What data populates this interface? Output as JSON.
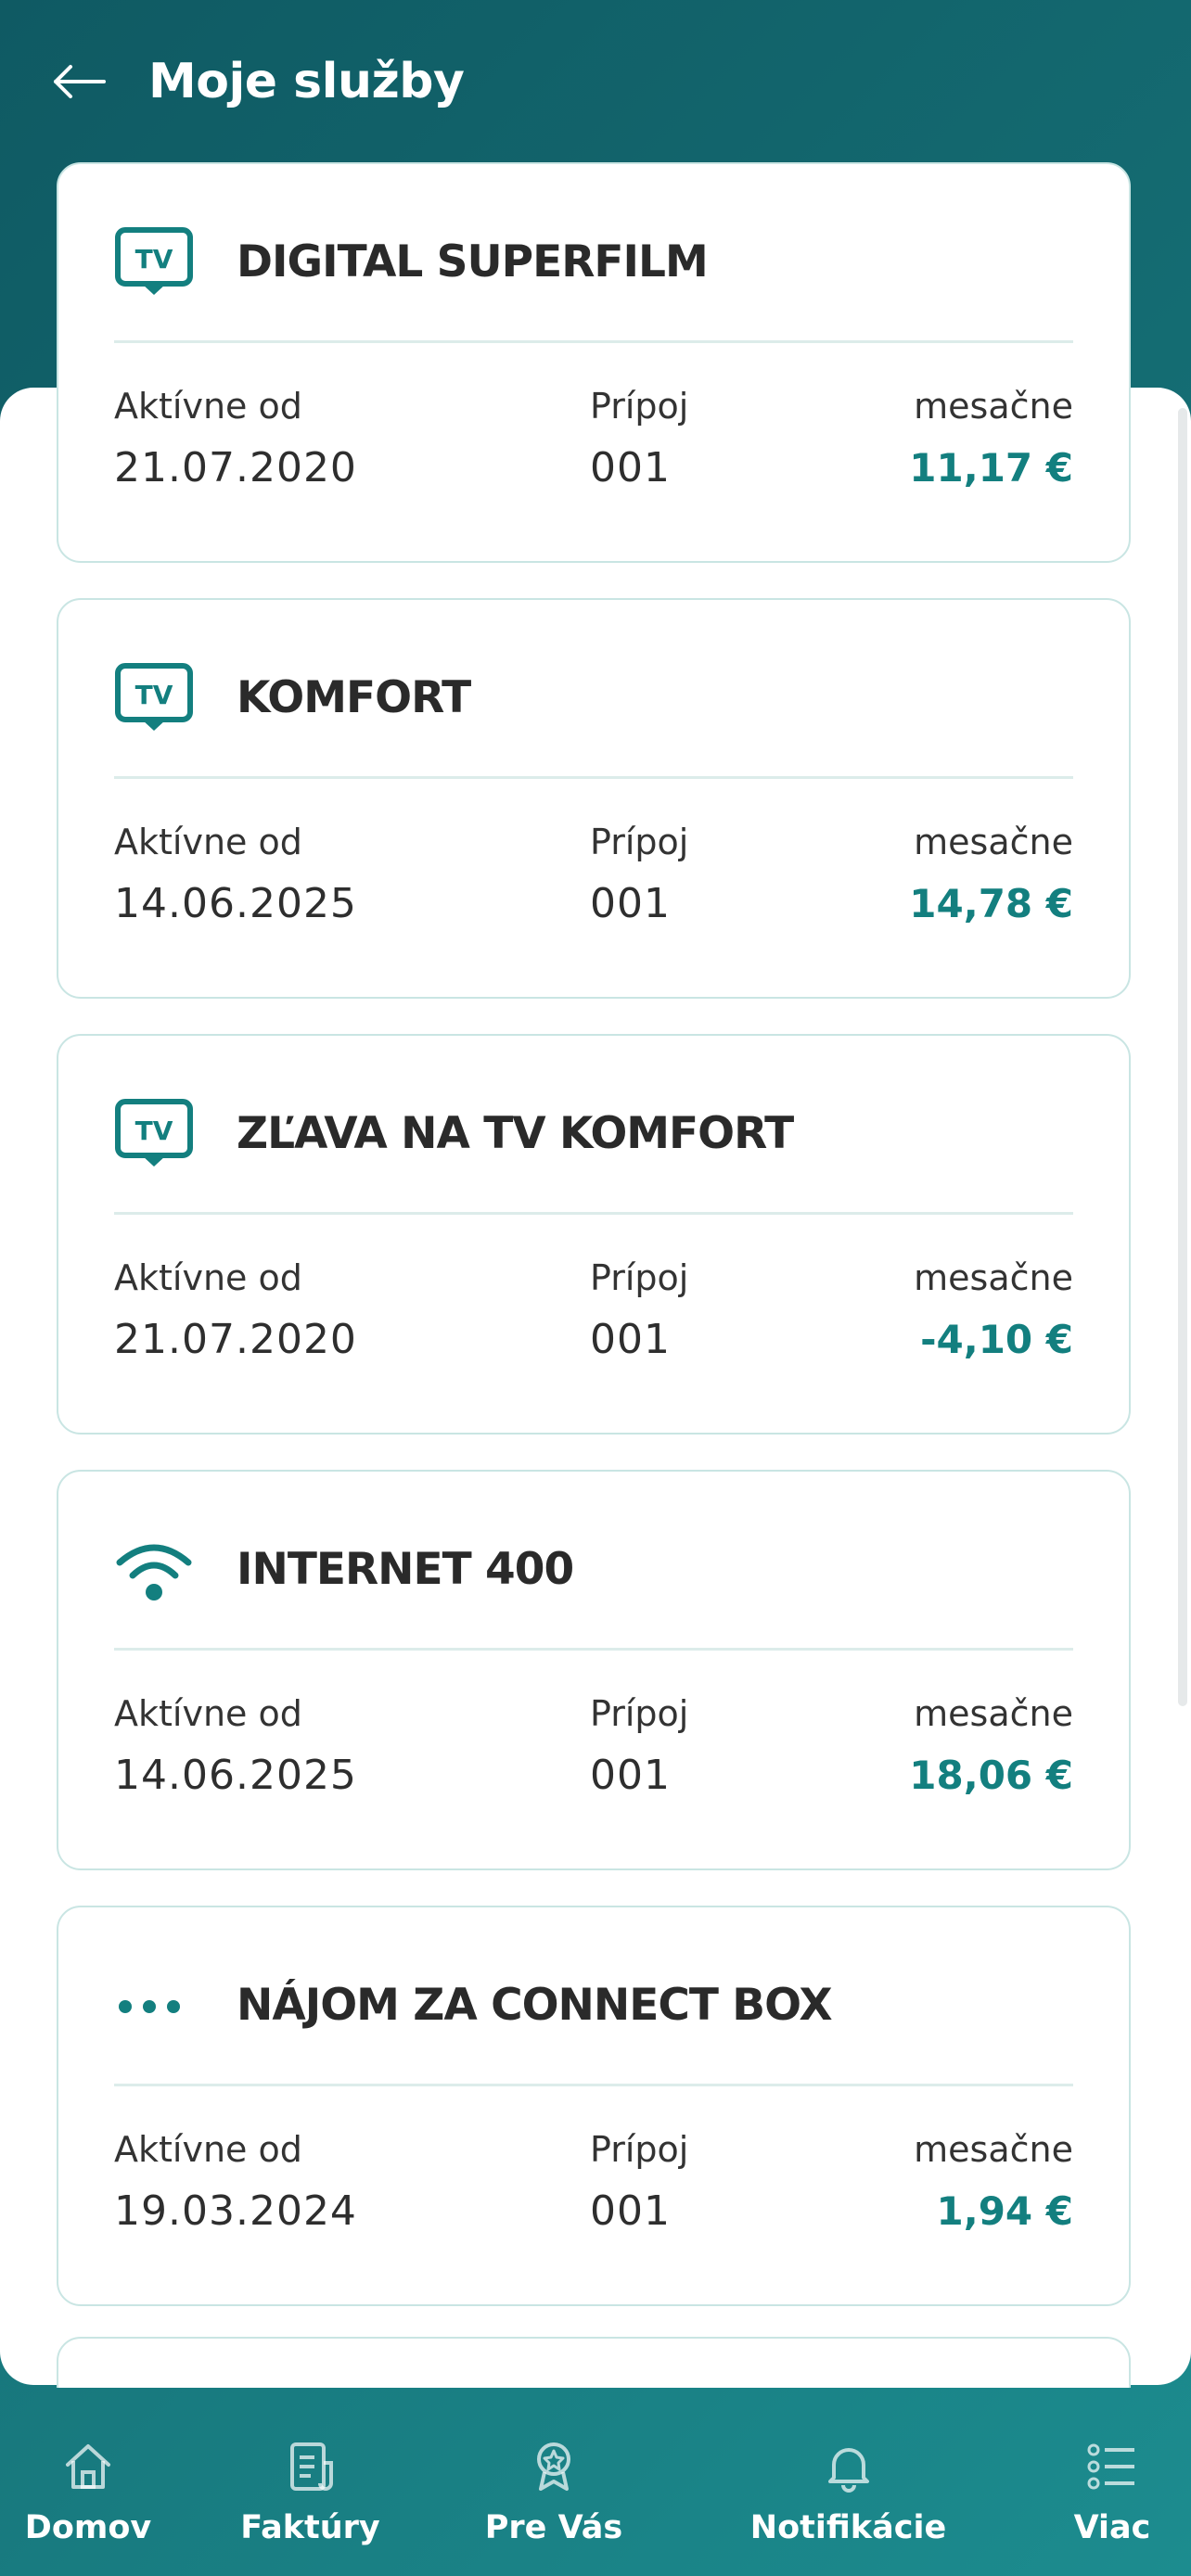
{
  "header": {
    "title": "Moje služby",
    "back_icon": "arrow-left-icon"
  },
  "services": [
    {
      "icon": "tv-icon",
      "name": "DIGITAL SUPERFILM",
      "active_label": "Aktívne od",
      "active_since": "21.07.2020",
      "connection_label": "Prípoj",
      "connection": "001",
      "monthly_label": "mesačne",
      "price": "11,17 €"
    },
    {
      "icon": "tv-icon",
      "name": "KOMFORT",
      "active_label": "Aktívne od",
      "active_since": "14.06.2025",
      "connection_label": "Prípoj",
      "connection": "001",
      "monthly_label": "mesačne",
      "price": "14,78 €"
    },
    {
      "icon": "tv-icon",
      "name": "ZĽAVA NA TV KOMFORT",
      "active_label": "Aktívne od",
      "active_since": "21.07.2020",
      "connection_label": "Prípoj",
      "connection": "001",
      "monthly_label": "mesačne",
      "price": "-4,10 €"
    },
    {
      "icon": "wifi-icon",
      "name": "INTERNET 400",
      "active_label": "Aktívne od",
      "active_since": "14.06.2025",
      "connection_label": "Prípoj",
      "connection": "001",
      "monthly_label": "mesačne",
      "price": "18,06 €"
    },
    {
      "icon": "more-dots-icon",
      "name": "NÁJOM ZA CONNECT BOX",
      "active_label": "Aktívne od",
      "active_since": "19.03.2024",
      "connection_label": "Prípoj",
      "connection": "001",
      "monthly_label": "mesačne",
      "price": "1,94 €"
    }
  ],
  "bottom_nav": [
    {
      "label": "Domov",
      "icon": "home-icon"
    },
    {
      "label": "Faktúry",
      "icon": "invoice-icon"
    },
    {
      "label": "Pre Vás",
      "icon": "award-icon"
    },
    {
      "label": "Notifikácie",
      "icon": "bell-icon"
    },
    {
      "label": "Viac",
      "icon": "menu-list-icon"
    }
  ],
  "colors": {
    "accent": "#137f7f",
    "header_bg": "#156e74",
    "card_border": "#c9e5e3",
    "text": "#2a2a2a"
  }
}
